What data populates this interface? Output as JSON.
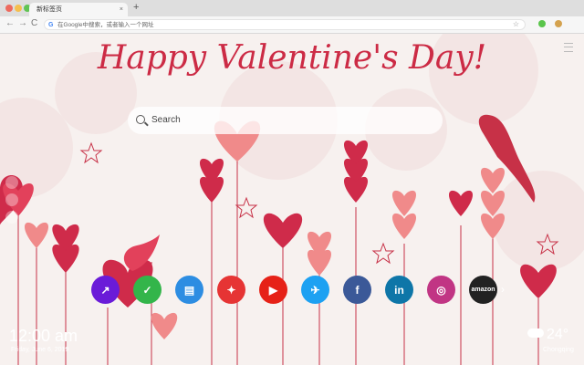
{
  "browser": {
    "tab_title": "新标签页",
    "close": "×",
    "new_tab": "+",
    "back": "←",
    "forward": "→",
    "reload": "C",
    "address_placeholder": "在Google中搜索，或者输入一个网址",
    "google_g": "G",
    "bookmark_star": "☆"
  },
  "page": {
    "title": "Happy Valentine's Day!",
    "search_placeholder": "Search",
    "shortcuts": [
      {
        "name": "photo-editor",
        "glyph": "↗",
        "color": "#6a1bd8"
      },
      {
        "name": "tasks",
        "glyph": "✓",
        "color": "#33b54a"
      },
      {
        "name": "notes",
        "glyph": "▤",
        "color": "#2d8de2"
      },
      {
        "name": "game",
        "glyph": "✦",
        "color": "#e63434"
      },
      {
        "name": "youtube",
        "glyph": "▶",
        "color": "#e62117"
      },
      {
        "name": "twitter",
        "glyph": "✈",
        "color": "#1da1f2"
      },
      {
        "name": "facebook",
        "glyph": "f",
        "color": "#3b5998"
      },
      {
        "name": "linkedin",
        "glyph": "in",
        "color": "#0e76a8"
      },
      {
        "name": "instagram",
        "glyph": "◎",
        "color": "#c13584"
      },
      {
        "name": "amazon",
        "glyph": "amazon",
        "color": "#222222"
      }
    ],
    "next_arrow": "›",
    "clock": "12:00 am",
    "date": "Friday, June 6, 2019",
    "temperature": "24°",
    "city": "Chongqing"
  }
}
